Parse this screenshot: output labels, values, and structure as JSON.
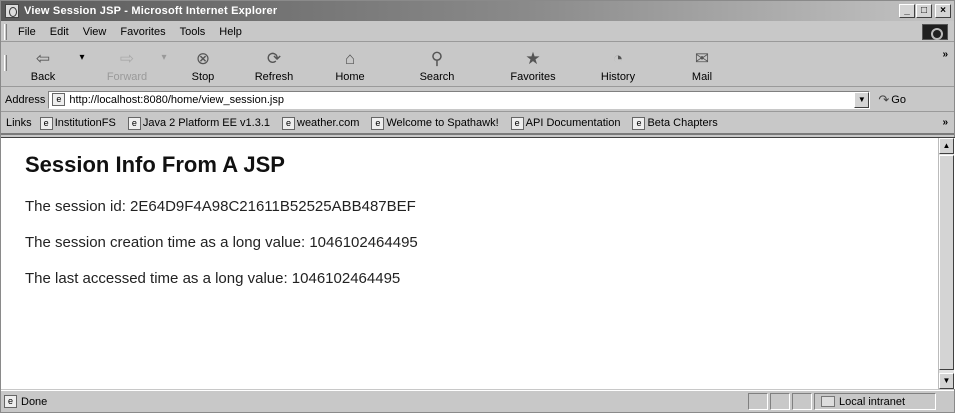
{
  "window": {
    "title": "View Session JSP - Microsoft Internet Explorer",
    "buttons": {
      "minimize": "_",
      "maximize": "□",
      "close": "×"
    }
  },
  "menubar": {
    "items": [
      {
        "label": "File"
      },
      {
        "label": "Edit"
      },
      {
        "label": "View"
      },
      {
        "label": "Favorites"
      },
      {
        "label": "Tools"
      },
      {
        "label": "Help"
      }
    ]
  },
  "toolbar": {
    "buttons": [
      {
        "label": "Back",
        "icon": "back-arrow-icon",
        "glyph": "⇦",
        "enabled": true
      },
      {
        "label": "Forward",
        "icon": "forward-arrow-icon",
        "glyph": "⇨",
        "enabled": false
      },
      {
        "label": "Stop",
        "icon": "stop-icon",
        "glyph": "⊗",
        "enabled": true
      },
      {
        "label": "Refresh",
        "icon": "refresh-icon",
        "glyph": "⟳",
        "enabled": true
      },
      {
        "label": "Home",
        "icon": "home-icon",
        "glyph": "⌂",
        "enabled": true
      },
      {
        "label": "Search",
        "icon": "search-icon",
        "glyph": "⚲",
        "enabled": true
      },
      {
        "label": "Favorites",
        "icon": "favorites-icon",
        "glyph": "★",
        "enabled": true
      },
      {
        "label": "History",
        "icon": "history-icon",
        "glyph": "◔",
        "enabled": true
      },
      {
        "label": "Mail",
        "icon": "mail-icon",
        "glyph": "✉",
        "enabled": true
      }
    ],
    "overflow": "»"
  },
  "addressbar": {
    "label": "Address",
    "url": "http://localhost:8080/home/view_session.jsp",
    "go_label": "Go"
  },
  "linksbar": {
    "label": "Links",
    "overflow": "»",
    "items": [
      {
        "label": "InstitutionFS"
      },
      {
        "label": "Java 2 Platform EE v1.3.1"
      },
      {
        "label": "weather.com"
      },
      {
        "label": "Welcome to Spathawk!"
      },
      {
        "label": "API Documentation"
      },
      {
        "label": "Beta Chapters"
      }
    ]
  },
  "page": {
    "heading": "Session Info From A JSP",
    "lines": [
      "The session id: 2E64D9F4A98C21611B52525ABB487BEF",
      "The session creation time as a long value: 1046102464495",
      "The last accessed time as a long value: 1046102464495"
    ]
  },
  "statusbar": {
    "status": "Done",
    "zone": "Local intranet"
  }
}
